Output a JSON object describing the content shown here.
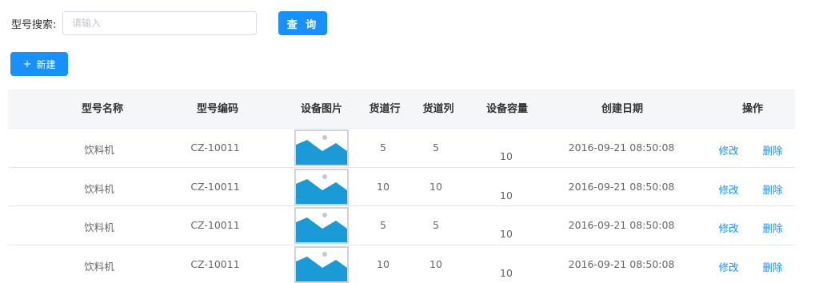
{
  "search": {
    "label": "型号搜索:",
    "placeholder": "请输入",
    "query_label": "查 询"
  },
  "toolbar": {
    "new_plus": "+",
    "new_label": "新建"
  },
  "table": {
    "columns": [
      "型号名称",
      "型号编码",
      "设备图片",
      "货道行",
      "货道列",
      "设备容量",
      "创建日期",
      "操作"
    ],
    "rows": [
      {
        "name": "饮料机",
        "code": "CZ-10011",
        "row": "5",
        "col": "5",
        "capacity": "10",
        "date": "2016-09-21  08:50:08",
        "edit": "修改",
        "delete": "删除"
      },
      {
        "name": "饮料机",
        "code": "CZ-10011",
        "row": "10",
        "col": "10",
        "capacity": "10",
        "date": "2016-09-21  08:50:08",
        "edit": "修改",
        "delete": "删除"
      },
      {
        "name": "饮料机",
        "code": "CZ-10011",
        "row": "5",
        "col": "5",
        "capacity": "10",
        "date": "2016-09-21  08:50:08",
        "edit": "修改",
        "delete": "删除"
      },
      {
        "name": "饮料机",
        "code": "CZ-10011",
        "row": "10",
        "col": "10",
        "capacity": "10",
        "date": "2016-09-21  08:50:08",
        "edit": "修改",
        "delete": "删除"
      }
    ],
    "thumbnail_icon": "image-placeholder-icon"
  },
  "colors": {
    "accent": "#1890ff",
    "header_bg": "#f5f6f8",
    "thumb_fill": "#1a9bd7",
    "thumb_dot": "#c8c8c8"
  }
}
